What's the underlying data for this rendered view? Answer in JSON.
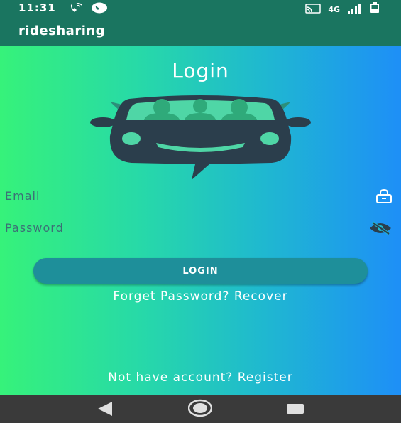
{
  "status_bar": {
    "time": "11:31",
    "icons": [
      "wifi-call-icon",
      "message-icon",
      "cast-icon",
      "4g-lte-icon",
      "signal-icon",
      "battery-icon"
    ],
    "network_label": "4G"
  },
  "app_bar": {
    "title": "ridesharing"
  },
  "screen": {
    "title": "Login",
    "logo_icon": "car-logo-icon",
    "email": {
      "placeholder": "Email",
      "value": "",
      "icon": "lock-icon"
    },
    "password": {
      "placeholder": "Password",
      "value": "",
      "icon": "visibility-off-icon"
    },
    "login_button": "LOGIN",
    "forgot_link": "Forget Password? Recover",
    "register_link": "Not have account? Register"
  },
  "nav_bar": {
    "buttons": [
      "back-icon",
      "home-icon",
      "recents-icon"
    ]
  },
  "colors": {
    "app_bar": "#1a7560",
    "gradient_start": "#36f27a",
    "gradient_end": "#1e8ff7",
    "button": "#1e8f9a",
    "nav_bar": "#3a3a3a",
    "logo_dark": "#2b3e4c"
  }
}
